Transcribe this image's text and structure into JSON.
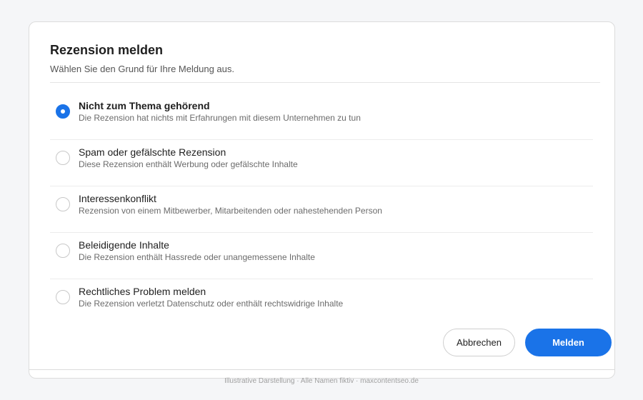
{
  "dialog": {
    "title": "Rezension melden",
    "subtitle": "Wählen Sie den Grund für Ihre Meldung aus."
  },
  "options": [
    {
      "label": "Nicht zum Thema gehörend",
      "description": "Die Rezension hat nichts mit Erfahrungen mit diesem Unternehmen zu tun",
      "selected": true
    },
    {
      "label": "Spam oder gefälschte Rezension",
      "description": "Diese Rezension enthält Werbung oder gefälschte Inhalte",
      "selected": false
    },
    {
      "label": "Interessenkonflikt",
      "description": "Rezension von einem Mitbewerber, Mitarbeitenden oder nahestehenden Person",
      "selected": false
    },
    {
      "label": "Beleidigende Inhalte",
      "description": "Die Rezension enthält Hassrede oder unangemessene Inhalte",
      "selected": false
    },
    {
      "label": "Rechtliches Problem melden",
      "description": "Die Rezension verletzt Datenschutz oder enthält rechtswidrige Inhalte",
      "selected": false
    }
  ],
  "actions": {
    "cancel_label": "Abbrechen",
    "submit_label": "Melden"
  },
  "footer": {
    "text": "Illustrative Darstellung · Alle Namen fiktiv · maxcontentseo.de"
  },
  "colors": {
    "accent": "#1a73e8",
    "background": "#f5f6f8"
  }
}
